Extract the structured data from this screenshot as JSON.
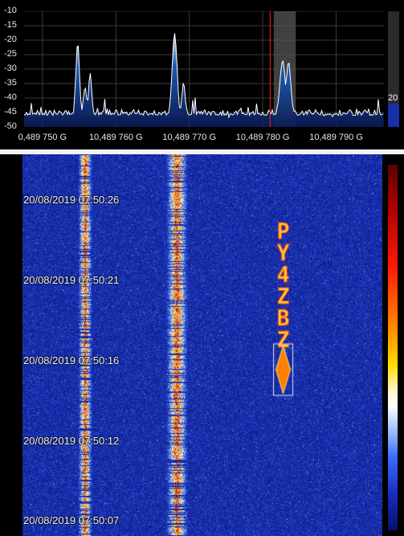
{
  "spectrum": {
    "y_ticks": [
      "-10",
      "-15",
      "-20",
      "-25",
      "-30",
      "-35",
      "-40",
      "-45",
      "-50"
    ],
    "x_ticks": [
      "0,489 750 G",
      "10,489 760 G",
      "10,489 770 G",
      "10,489 780 G",
      "10,489 790 G"
    ],
    "level_value": "20",
    "level_fraction": 0.2,
    "colors": {
      "trace": "#ffffff",
      "fill": "#1e63c8",
      "marker": "#ff2020",
      "selection": "#555555",
      "grid": "#3a3a3a"
    }
  },
  "chart_data": {
    "type": "line",
    "title": "",
    "xlabel": "",
    "ylabel": "",
    "x_unit": "GHz",
    "xlim": [
      10489.7475,
      10489.7965
    ],
    "ylim": [
      -50,
      -10
    ],
    "grid": true,
    "marker_freq": 10489.781,
    "selection_range": [
      10489.7815,
      10489.7845
    ],
    "peaks": [
      {
        "x": 10489.7548,
        "y": -21
      },
      {
        "x": 10489.7558,
        "y": -36
      },
      {
        "x": 10489.7565,
        "y": -32
      },
      {
        "x": 10489.768,
        "y": -17
      },
      {
        "x": 10489.7692,
        "y": -35
      },
      {
        "x": 10489.7827,
        "y": -27
      },
      {
        "x": 10489.7835,
        "y": -28
      }
    ],
    "noise_floor": -46
  },
  "waterfall": {
    "timestamps": [
      "20/08/2019 07:50:26",
      "20/08/2019 07:50:21",
      "20/08/2019 07:50:16",
      "20/08/2019 07:50:12",
      "20/08/2019 07:50:07"
    ],
    "decoded_text": "PY4ZBZ"
  }
}
